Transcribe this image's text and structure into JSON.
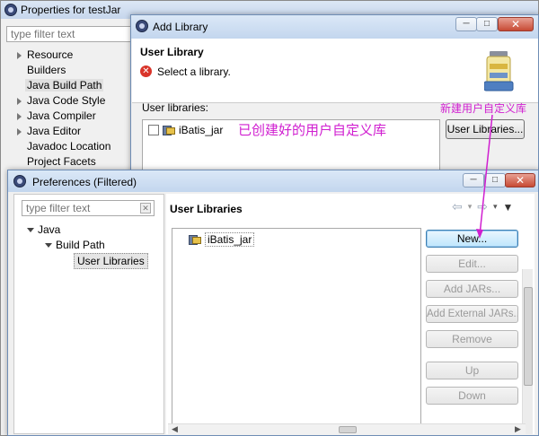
{
  "properties_window": {
    "title": "Properties for testJar",
    "filter_placeholder": "type filter text",
    "tree": [
      {
        "label": "Resource",
        "expandable": true
      },
      {
        "label": "Builders",
        "expandable": false
      },
      {
        "label": "Java Build Path",
        "expandable": false,
        "selected": true
      },
      {
        "label": "Java Code Style",
        "expandable": true
      },
      {
        "label": "Java Compiler",
        "expandable": true
      },
      {
        "label": "Java Editor",
        "expandable": true
      },
      {
        "label": "Javadoc Location",
        "expandable": false
      },
      {
        "label": "Project Facets",
        "expandable": false
      }
    ]
  },
  "add_library_dialog": {
    "title": "Add Library",
    "header_title": "User Library",
    "header_message": "Select a library.",
    "list_label": "User libraries:",
    "libraries": [
      {
        "name": "iBatis_jar",
        "checked": false
      }
    ],
    "user_libraries_button": "User Libraries..."
  },
  "preferences_dialog": {
    "title": "Preferences (Filtered)",
    "filter_placeholder": "type filter text",
    "tree": [
      {
        "label": "Java",
        "level": 0
      },
      {
        "label": "Build Path",
        "level": 1
      },
      {
        "label": "User Libraries",
        "level": 2,
        "selected": true
      }
    ],
    "page_title": "User Libraries",
    "libraries": [
      "iBatis_jar"
    ],
    "buttons": {
      "new": "New...",
      "edit": "Edit...",
      "add_jars": "Add JARs...",
      "add_external_jars": "Add External JARs...",
      "remove": "Remove",
      "up": "Up",
      "down": "Down"
    }
  },
  "annotations": {
    "created_library_note": "已创建好的用户自定义库",
    "new_library_note": "新建用户自定义库",
    "color": "#d01ed0"
  }
}
